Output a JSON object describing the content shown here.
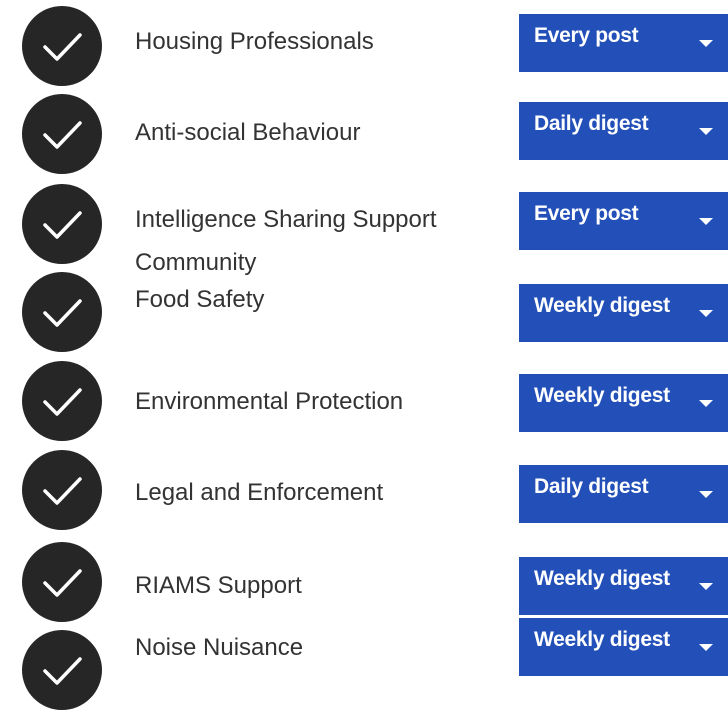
{
  "subscriptions": [
    {
      "group": "Housing Professionals",
      "frequency": "Every post",
      "checked": true
    },
    {
      "group": "Anti-social Behaviour",
      "frequency": "Daily digest",
      "checked": true
    },
    {
      "group": "Intelligence Sharing Support Community",
      "frequency": "Every post",
      "checked": true
    },
    {
      "group": "Food Safety",
      "frequency": "Weekly digest",
      "checked": true
    },
    {
      "group": "Environmental Protection",
      "frequency": "Weekly digest",
      "checked": true
    },
    {
      "group": "Legal and Enforcement",
      "frequency": "Daily digest",
      "checked": true
    },
    {
      "group": "RIAMS Support",
      "frequency": "Weekly digest",
      "checked": true
    },
    {
      "group": "Noise Nuisance",
      "frequency": "Weekly digest",
      "checked": true
    }
  ],
  "colors": {
    "check_fill": "#262626",
    "checkmark": "#ffffff",
    "dropdown_bg": "#2350b8",
    "dropdown_text": "#ffffff",
    "label_text": "#333333"
  },
  "icons": {
    "check": "check-circle-icon",
    "caret": "caret-down-icon"
  }
}
